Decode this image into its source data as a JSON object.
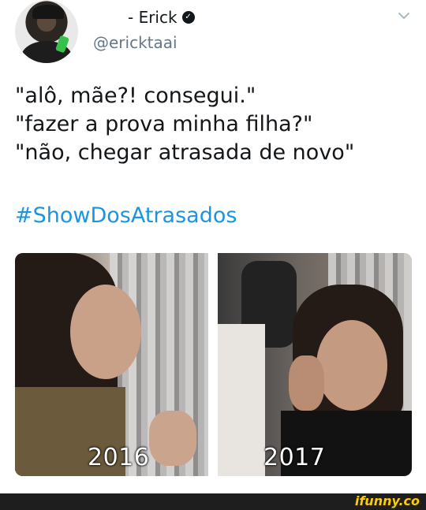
{
  "tweet": {
    "name": "- Erick",
    "verified_icon": "verified-badge-icon",
    "handle": "@ericktaai",
    "menu_icon": "chevron-down-icon",
    "text_lines": [
      "\"alô, mãe?! consegui.\"",
      "\"fazer a prova minha filha?\"",
      "\"não, chegar atrasada de novo\""
    ],
    "hashtag": "#ShowDosAtrasados"
  },
  "media": {
    "left_caption": "2016",
    "right_caption": "2017"
  },
  "footer": {
    "watermark": "ifunny.co"
  },
  "colors": {
    "text": "#14171a",
    "secondary": "#657786",
    "link": "#1b95e0",
    "watermark": "#ffcc00"
  }
}
